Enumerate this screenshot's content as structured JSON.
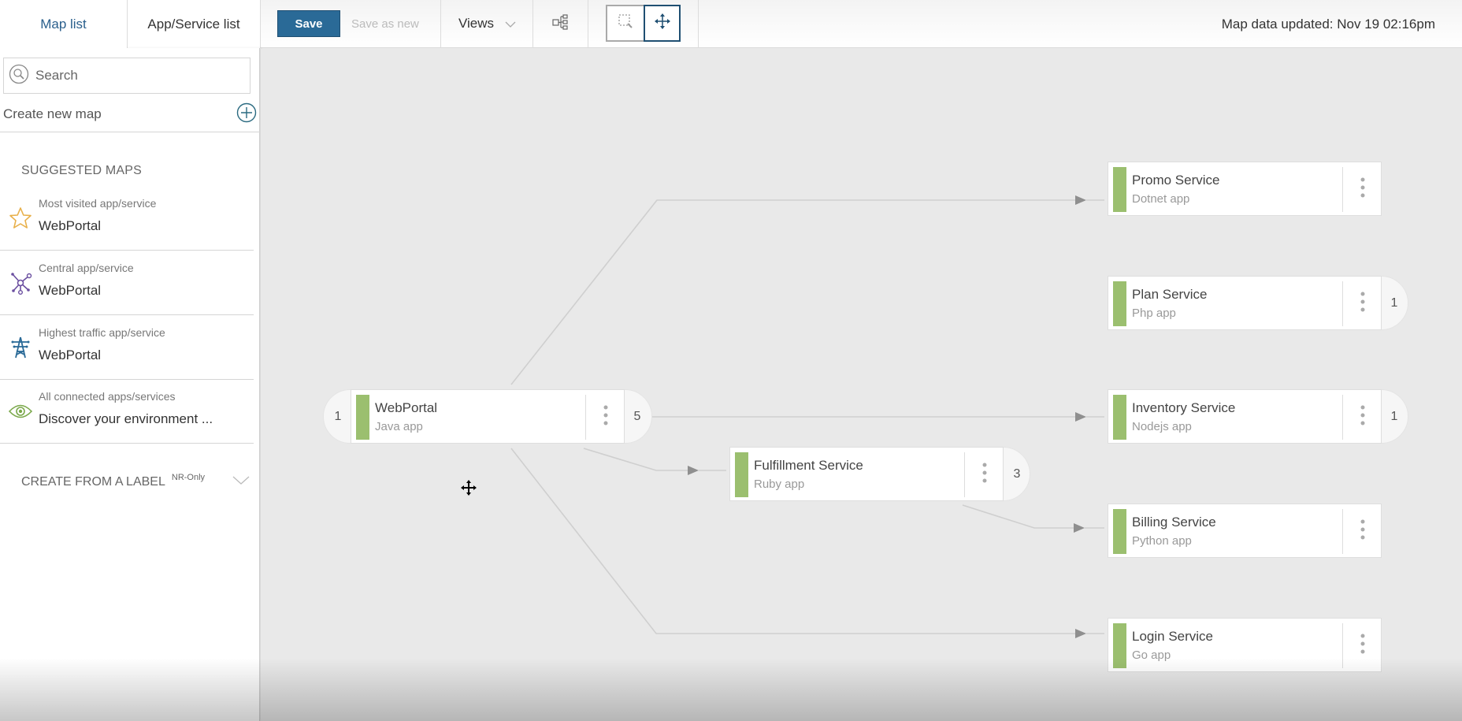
{
  "toolbar": {
    "tabs": [
      {
        "label": "Map list",
        "active": true
      },
      {
        "label": "App/Service list",
        "active": false
      }
    ],
    "save_label": "Save",
    "save_as_new_label": "Save as new",
    "views_label": "Views",
    "layout_icon": "tree-layout-icon",
    "select_mode_icon": "marquee-select-icon",
    "pan_mode_icon": "move-arrows-icon",
    "active_mode": "pan",
    "map_data_updated": "Map data updated: Nov 19 02:16pm"
  },
  "sidebar": {
    "search_placeholder": "Search",
    "create_new_map_label": "Create new map",
    "suggested_maps_heading": "SUGGESTED MAPS",
    "suggested": [
      {
        "caption": "Most visited app/service",
        "value": "WebPortal",
        "icon": "star-icon",
        "icon_color": "#e8b04a"
      },
      {
        "caption": "Central app/service",
        "value": "WebPortal",
        "icon": "network-hub-icon",
        "icon_color": "#6b4fa0"
      },
      {
        "caption": "Highest traffic app/service",
        "value": "WebPortal",
        "icon": "transmission-tower-icon",
        "icon_color": "#2a6a97"
      },
      {
        "caption": "All connected apps/services",
        "value": "Discover your environment  ...",
        "icon": "eye-icon",
        "icon_color": "#7aa84a"
      }
    ],
    "create_from_label_heading": "CREATE FROM A LABEL",
    "create_from_label_badge": "NR-Only"
  },
  "map": {
    "health_color": "#9bbf6f",
    "nodes": [
      {
        "id": "webportal",
        "name": "WebPortal",
        "type": "Java app",
        "count_in": "1",
        "count_out": "5"
      },
      {
        "id": "fulfillment",
        "name": "Fulfillment Service",
        "type": "Ruby app",
        "count_in": null,
        "count_out": "3"
      },
      {
        "id": "promo",
        "name": "Promo Service",
        "type": "Dotnet app",
        "count_in": null,
        "count_out": null
      },
      {
        "id": "plan",
        "name": "Plan Service",
        "type": "Php app",
        "count_in": null,
        "count_out": "1"
      },
      {
        "id": "inventory",
        "name": "Inventory Service",
        "type": "Nodejs app",
        "count_in": null,
        "count_out": "1"
      },
      {
        "id": "billing",
        "name": "Billing Service",
        "type": "Python app",
        "count_in": null,
        "count_out": null
      },
      {
        "id": "login",
        "name": "Login Service",
        "type": "Go app",
        "count_in": null,
        "count_out": null
      }
    ],
    "edges": [
      {
        "from": "webportal",
        "to": "promo"
      },
      {
        "from": "webportal",
        "to": "inventory"
      },
      {
        "from": "webportal",
        "to": "fulfillment"
      },
      {
        "from": "webportal",
        "to": "login"
      },
      {
        "from": "fulfillment",
        "to": "billing"
      }
    ]
  }
}
